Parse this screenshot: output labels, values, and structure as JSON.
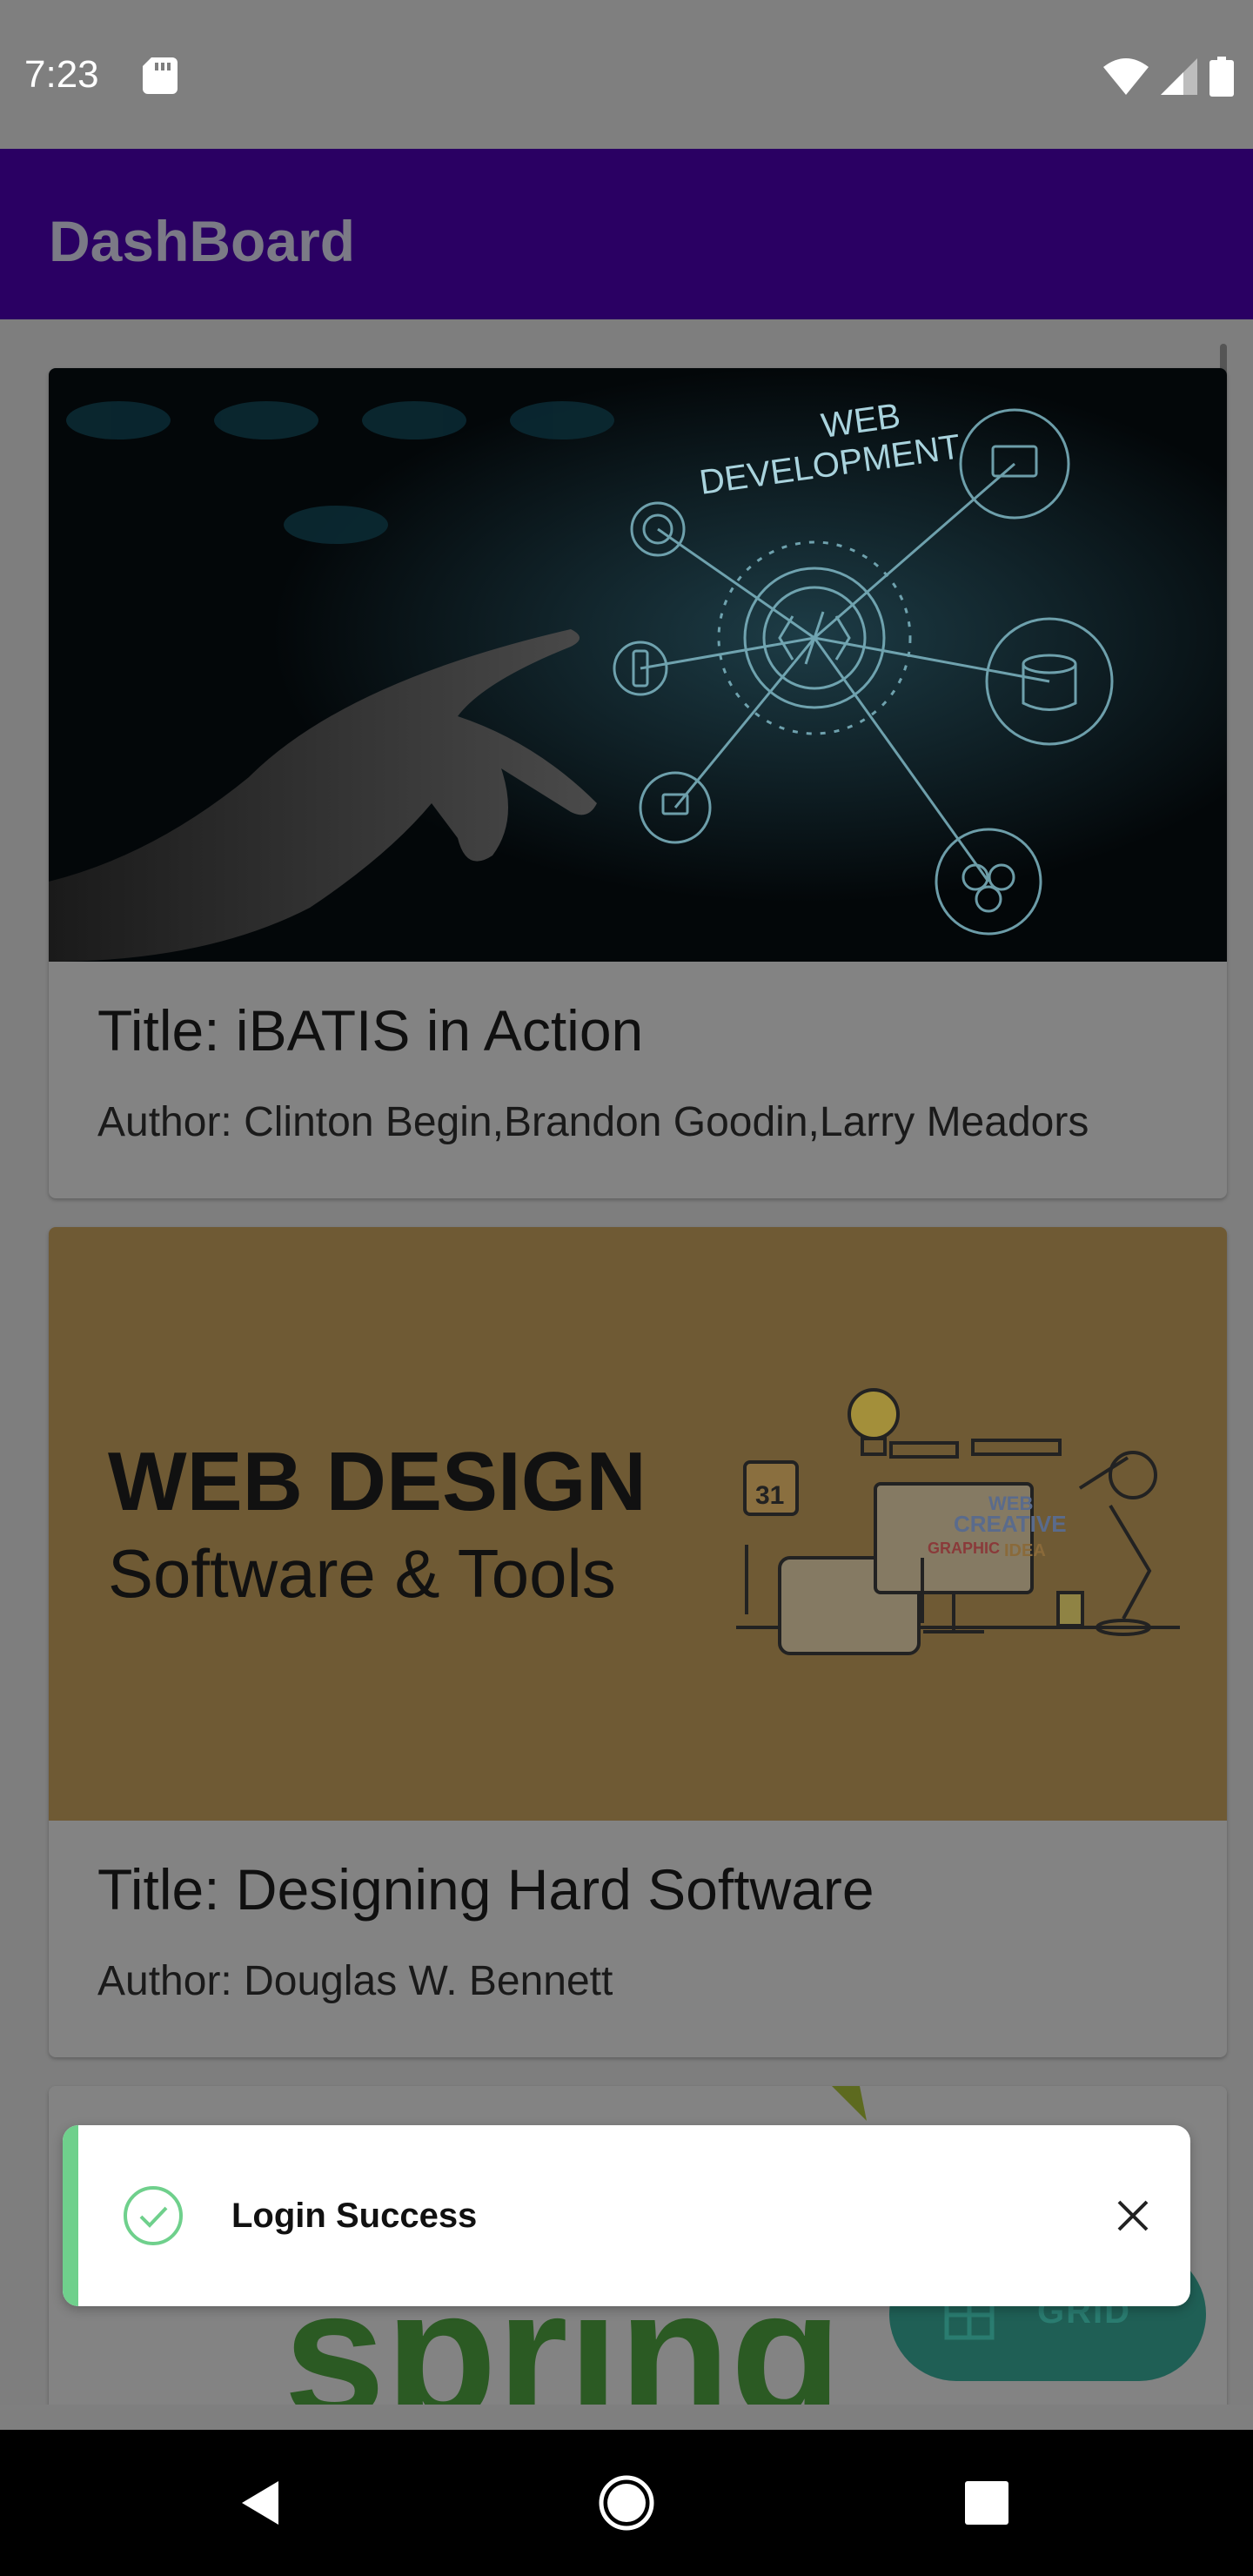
{
  "status_bar": {
    "time": "7:23",
    "icons": [
      "sd-card-icon",
      "wifi-icon",
      "signal-icon",
      "battery-icon"
    ]
  },
  "app_bar": {
    "title": "DashBoard",
    "color": "#2a0063"
  },
  "books": [
    {
      "title": "Title: iBATIS in Action",
      "author": "Author: Clinton Begin,Brandon Goodin,Larry Meadors",
      "image_text": [
        "WEB",
        "DEVELOPMENT"
      ]
    },
    {
      "title": "Title: Designing Hard Software",
      "author": "Author: Douglas W. Bennett",
      "image_text": [
        "WEB DESIGN",
        "Software & Tools",
        "31",
        "WEB",
        "CREATIVE",
        "GRAPHIC",
        "IDEA"
      ]
    },
    {
      "title": "",
      "author": "",
      "image_text": [
        "spring"
      ]
    }
  ],
  "toast": {
    "message": "Login Success",
    "accent_color": "#6fd08c"
  },
  "fab": {
    "label": "GRID",
    "color": "#1f5f55"
  },
  "nav_bar": {
    "icons": [
      "back-icon",
      "home-icon",
      "recents-icon"
    ]
  }
}
